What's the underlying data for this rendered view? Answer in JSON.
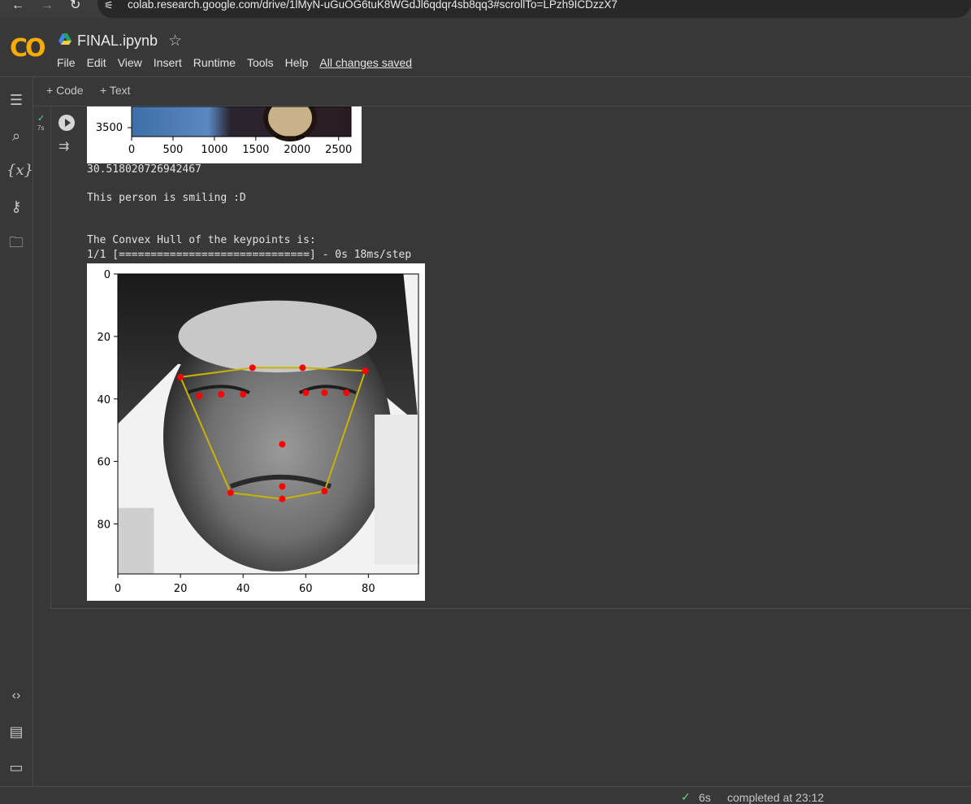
{
  "browser": {
    "url": "colab.research.google.com/drive/1lMyN-uGuOG6tuK8WGdJl6qdqr4sb8qq3#scrollTo=LPzh9ICDzzX7"
  },
  "header": {
    "logo": "CO",
    "title": "FINAL.ipynb",
    "menu": [
      "File",
      "Edit",
      "View",
      "Insert",
      "Runtime",
      "Tools",
      "Help"
    ],
    "save_status": "All changes saved"
  },
  "toolbar": {
    "code_label": "Code",
    "text_label": "Text"
  },
  "cell": {
    "exec_time": "7s",
    "outputs": {
      "score": "30.518020726942467",
      "smile_msg": "This person is smiling :D",
      "hull_msg": "The Convex Hull of the keypoints is:",
      "progress": "1/1 [==============================] - 0s 18ms/step"
    }
  },
  "chart_data": [
    {
      "type": "image",
      "xticks": [
        "0",
        "500",
        "1000",
        "1500",
        "2000",
        "2500"
      ],
      "yticks_visible": [
        "3500"
      ]
    },
    {
      "type": "scatter",
      "xticks": [
        "0",
        "20",
        "40",
        "60",
        "80"
      ],
      "yticks": [
        "0",
        "20",
        "40",
        "60",
        "80"
      ],
      "xlim": [
        0,
        96
      ],
      "ylim": [
        96,
        0
      ],
      "keypoints": [
        {
          "x": 26,
          "y": 39
        },
        {
          "x": 33,
          "y": 38.5
        },
        {
          "x": 40,
          "y": 38.5
        },
        {
          "x": 60,
          "y": 38
        },
        {
          "x": 66,
          "y": 38
        },
        {
          "x": 73,
          "y": 38
        },
        {
          "x": 20,
          "y": 33
        },
        {
          "x": 43,
          "y": 30
        },
        {
          "x": 59,
          "y": 30
        },
        {
          "x": 79,
          "y": 31
        },
        {
          "x": 52.5,
          "y": 54.5
        },
        {
          "x": 36,
          "y": 70
        },
        {
          "x": 66,
          "y": 69.5
        },
        {
          "x": 52.5,
          "y": 68
        },
        {
          "x": 52.5,
          "y": 72
        }
      ],
      "hull": [
        {
          "x": 20,
          "y": 33
        },
        {
          "x": 43,
          "y": 30
        },
        {
          "x": 59,
          "y": 30
        },
        {
          "x": 79,
          "y": 31
        },
        {
          "x": 66,
          "y": 69.5
        },
        {
          "x": 52.5,
          "y": 72
        },
        {
          "x": 36,
          "y": 70
        }
      ],
      "point_color": "#ff0000",
      "hull_color": "#c8b400"
    }
  ],
  "status": {
    "duration": "6s",
    "completed": "completed at 23:12"
  }
}
